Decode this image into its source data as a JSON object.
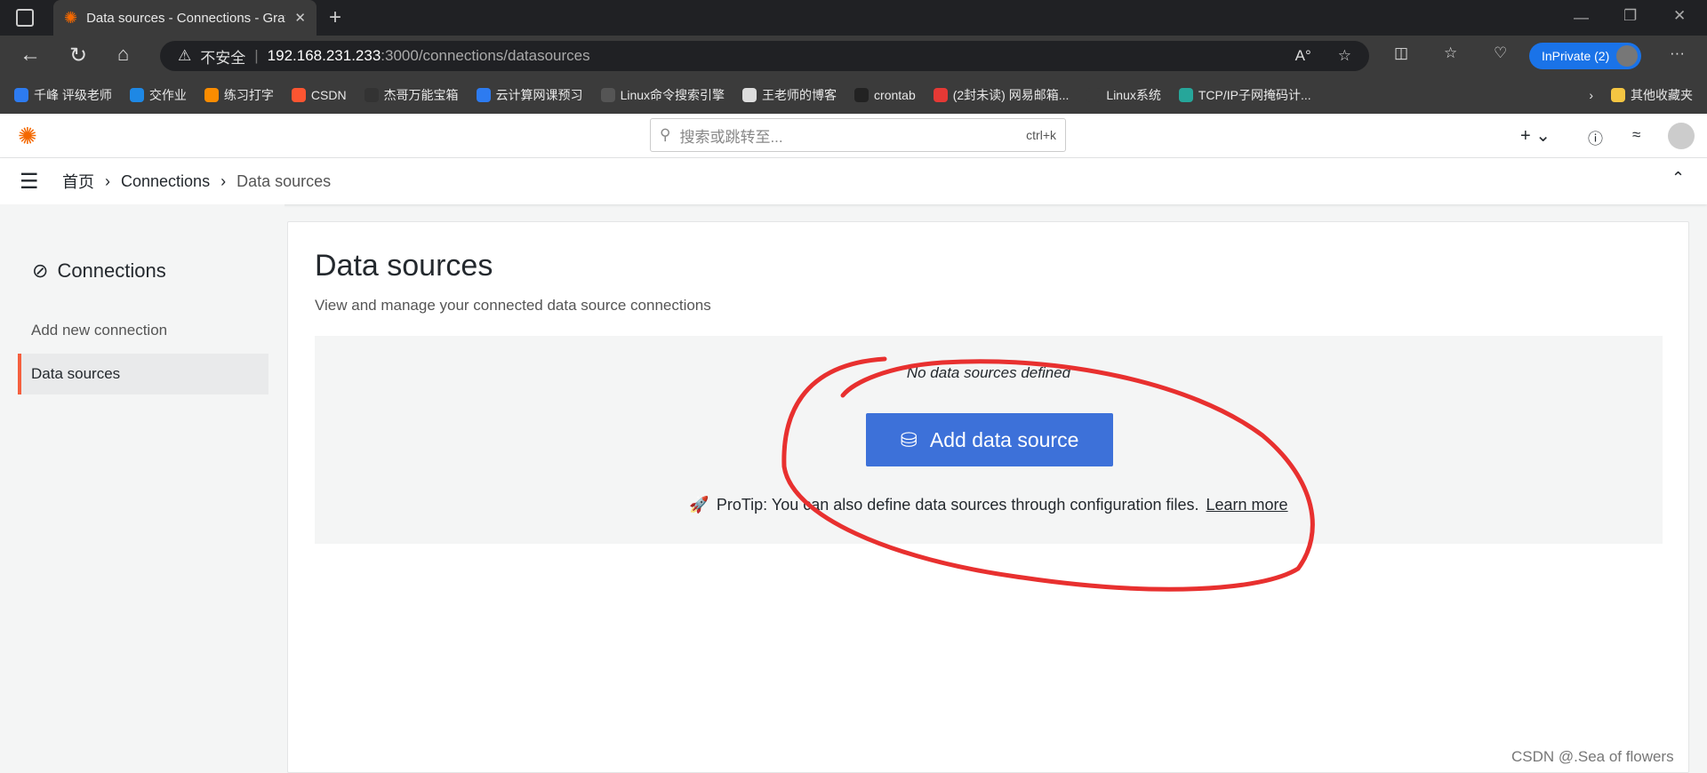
{
  "browser": {
    "tab_title": "Data sources - Connections - Grafana",
    "url_warning": "不安全",
    "url_host": "192.168.231.233",
    "url_path": ":3000/connections/datasources",
    "inprivate": "InPrivate (2)",
    "bookmarks": [
      {
        "label": "千峰 评级老师",
        "color": "#2d7bf0"
      },
      {
        "label": "交作业",
        "color": "#1e88e5"
      },
      {
        "label": "练习打字",
        "color": "#fb8c00"
      },
      {
        "label": "CSDN",
        "color": "#fc5531"
      },
      {
        "label": "杰哥万能宝箱",
        "color": "#333"
      },
      {
        "label": "云计算网课预习",
        "color": "#2d7bf0"
      },
      {
        "label": "Linux命令搜索引擎",
        "color": "#555"
      },
      {
        "label": "王老师的博客",
        "color": "#ddd"
      },
      {
        "label": "crontab",
        "color": "#222"
      },
      {
        "label": "(2封未读) 网易邮箱...",
        "color": "#e53935"
      },
      {
        "label": "Linux系统",
        "color": "#3b3b3b"
      },
      {
        "label": "TCP/IP子网掩码计...",
        "color": "#26a69a"
      }
    ],
    "other_bookmarks": "其他收藏夹"
  },
  "grafana": {
    "search_placeholder": "搜索或跳转至...",
    "search_shortcut": "ctrl+k",
    "breadcrumb": [
      "首页",
      "Connections",
      "Data sources"
    ],
    "sidebar": {
      "title": "Connections",
      "items": [
        "Add new connection",
        "Data sources"
      ]
    },
    "page_title": "Data sources",
    "page_subtitle": "View and manage your connected data source connections",
    "empty_text": "No data sources defined",
    "add_button": "Add data source",
    "protip_text": "ProTip: You can also define data sources through configuration files.",
    "protip_link": "Learn more"
  },
  "watermark": "CSDN @.Sea of flowers",
  "colors": {
    "accent": "#3d71d9",
    "annotation": "#e8302f",
    "active_bar": "#f55f3e"
  }
}
